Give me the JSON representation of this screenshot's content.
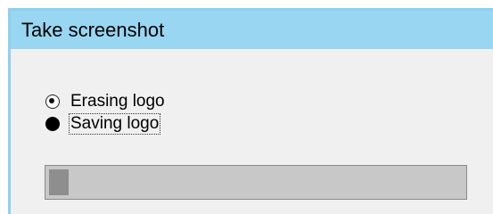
{
  "window": {
    "title": "Take screenshot"
  },
  "options": [
    {
      "label": "Erasing logo",
      "state": "checked"
    },
    {
      "label": "Saving logo",
      "state": "filled",
      "focused": true
    }
  ],
  "progress": {
    "value": 0.04
  },
  "colors": {
    "titlebar": "#98d6f2",
    "border": "#8fd0ee",
    "client_bg": "#f0f0f0",
    "progress_track": "#c8c8c8",
    "progress_fill": "#8e8e8e"
  }
}
